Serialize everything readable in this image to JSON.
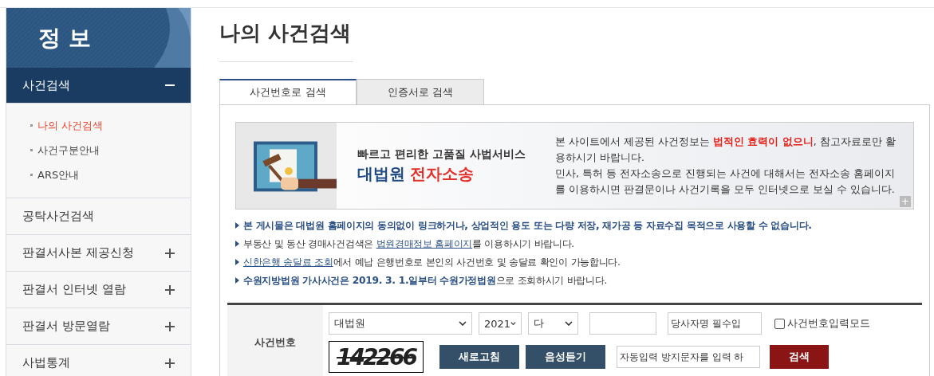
{
  "sidebar": {
    "title": "정 보",
    "items": [
      {
        "label": "사건검색",
        "expanded": true,
        "children": [
          {
            "label": "나의 사건검색",
            "selected": true
          },
          {
            "label": "사건구분안내",
            "selected": false
          },
          {
            "label": "ARS안내",
            "selected": false
          }
        ]
      },
      {
        "label": "공탁사건검색"
      },
      {
        "label": "판결서사본 제공신청",
        "expanded": false
      },
      {
        "label": "판결서 인터넷 열람",
        "expanded": false
      },
      {
        "label": "판결서 방문열람",
        "expanded": false
      },
      {
        "label": "사법통계",
        "expanded": false
      }
    ]
  },
  "page_title": "나의 사건검색",
  "tabs": [
    {
      "label": "사건번호로 검색",
      "selected": true
    },
    {
      "label": "인증서로 검색",
      "selected": false
    }
  ],
  "banner": {
    "tagline": "빠르고 편리한 고품질 사법서비스",
    "brand": "대법원",
    "brand_accent": "전자소송",
    "notice": [
      "본 사이트에서 제공된 사건정보는 **법적인 효력이 없으니**, 참고자료로만 활용하시기 바랍니다.",
      "민사, 특허 등 전자소송으로 진행되는 사건에 대해서는 전자소송 홈페이지를 이용하시면 판결문이나 사건기록을 모두 인터넷으로 보실 수 있습니다."
    ],
    "more": "+"
  },
  "notices": [
    {
      "before": "**본 게시물은 대법원 홈페이지의 동의없이 링크하거나, 상업적인 용도 또는 다량 저장, 재가공 등 자료수집 목적으로 사용할 수 없습니다.**"
    },
    {
      "before": "부동산 및 동산 경매사건검색은 ",
      "link": "법원경매정보 홈페이지",
      "after": "를 이용하시기 바랍니다."
    },
    {
      "link": "신한은행 송달료 조회",
      "after": "에서 예납 은행번호로 본인의 사건번호 및 송달료 확인이 가능합니다."
    },
    {
      "before": "**수원지방법원 가사사건은 2019. 3. 1.일부터 수원가정법원**으로 조회하시기 바랍니다."
    }
  ],
  "form": {
    "label": "사건번호",
    "court": "대법원",
    "year": "2021",
    "type": "다",
    "party_placeholder": "당사자명 필수입",
    "mode_label": "사건번호입력모드",
    "mode_checked": false,
    "captcha": "142266",
    "refresh": "새로고침",
    "audio": "음성듣기",
    "captcha_placeholder": "자동입력 방지문자를 입력 하",
    "search": "검색"
  }
}
